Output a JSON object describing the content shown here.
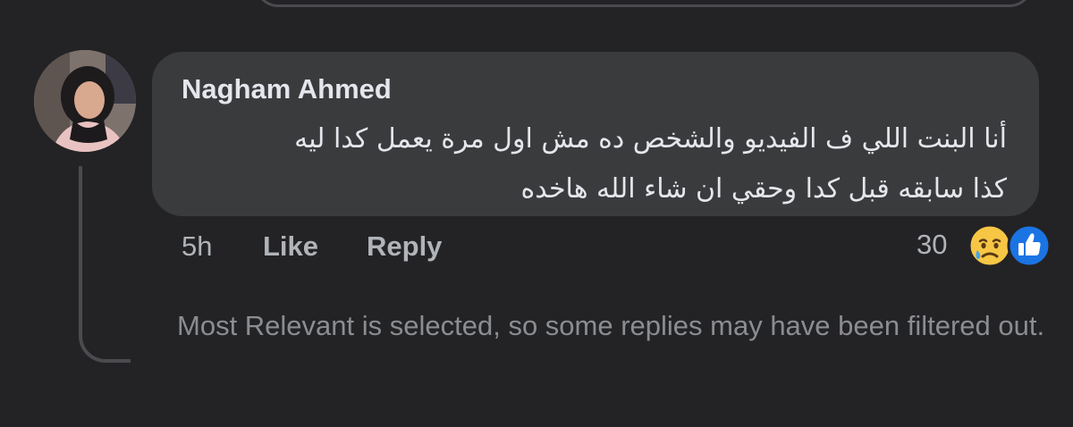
{
  "comment": {
    "author": "Nagham Ahmed",
    "text_lines": [
      "أنا البنت اللي ف الفيديو والشخص ده مش اول مرة يعمل كدا ليه",
      "كذا سابقه قبل كدا وحقي ان شاء الله هاخده"
    ],
    "timestamp": "5h",
    "like_label": "Like",
    "reply_label": "Reply",
    "reaction_count": "30",
    "reactions": [
      "sad-reaction",
      "like-reaction"
    ]
  },
  "filter_notice": "Most Relevant is selected, so some replies may have been filtered out.",
  "colors": {
    "background": "#232325",
    "bubble": "#3a3b3d",
    "primary_text": "#e4e6eb",
    "secondary_text": "#b0b3b8",
    "muted_text": "#8a8d91",
    "like_blue": "#1b74e4"
  }
}
